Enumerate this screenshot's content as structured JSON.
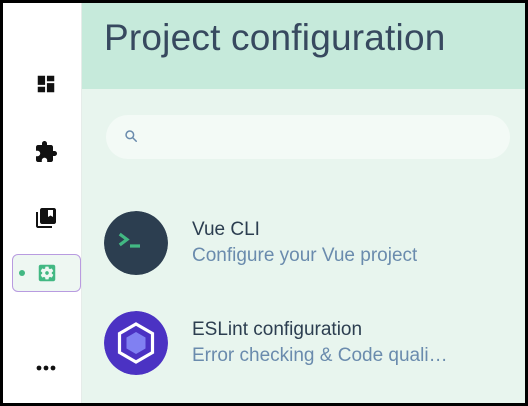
{
  "header": {
    "title": "Project configuration"
  },
  "search": {
    "placeholder": "",
    "value": ""
  },
  "sidebar": {
    "items": [
      {
        "name": "dashboard",
        "icon": "dashboard-icon"
      },
      {
        "name": "plugins",
        "icon": "puzzle-icon"
      },
      {
        "name": "dependencies",
        "icon": "library-books-icon"
      },
      {
        "name": "configuration",
        "icon": "settings-applications-icon",
        "active": true
      },
      {
        "name": "more",
        "icon": "more-horizontal-icon"
      }
    ]
  },
  "configurations": [
    {
      "title": "Vue CLI",
      "description": "Configure your Vue project",
      "icon": "vue-cli-icon"
    },
    {
      "title": "ESLint configuration",
      "description": "Error checking & Code quali…",
      "icon": "eslint-icon"
    }
  ],
  "colors": {
    "accent": "#42b883",
    "header_bg": "#c6eadb",
    "main_bg": "#e8f5ee",
    "text": "#2c3e50",
    "subtext": "#6a8bad",
    "active_border": "#b89be0",
    "vue_cli_bg": "#2c3e50",
    "eslint_bg": "#4b32c3"
  }
}
